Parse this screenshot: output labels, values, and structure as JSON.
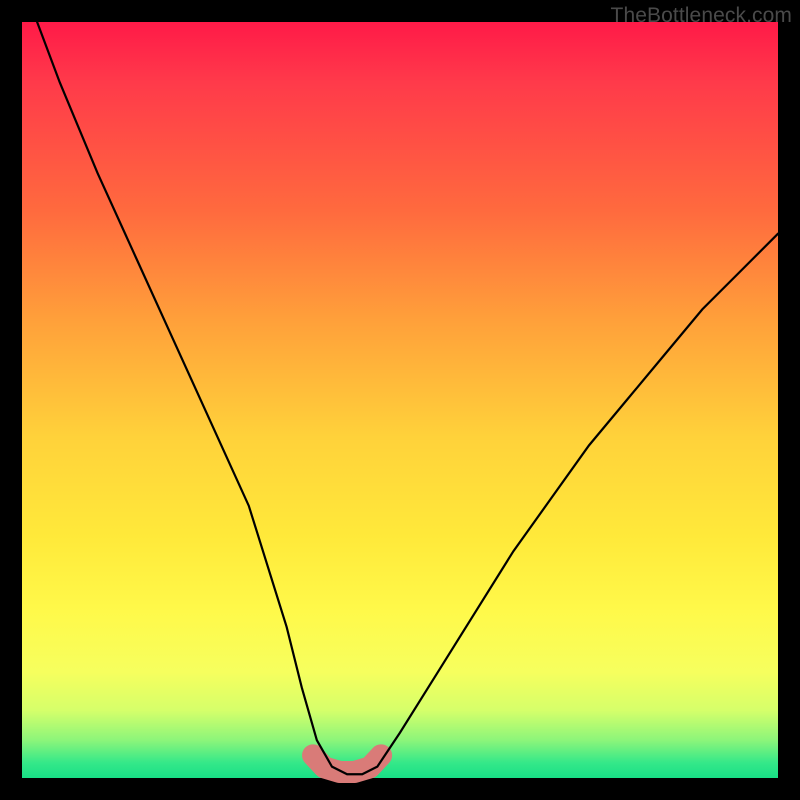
{
  "watermark": "TheBottleneck.com",
  "chart_data": {
    "type": "line",
    "title": "",
    "xlabel": "",
    "ylabel": "",
    "xlim": [
      0,
      100
    ],
    "ylim": [
      0,
      100
    ],
    "series": [
      {
        "name": "bottleneck-curve",
        "x": [
          2,
          5,
          10,
          15,
          20,
          25,
          30,
          35,
          37,
          39,
          41,
          43,
          45,
          47,
          50,
          55,
          60,
          65,
          70,
          75,
          80,
          85,
          90,
          95,
          100
        ],
        "values": [
          100,
          92,
          80,
          69,
          58,
          47,
          36,
          20,
          12,
          5,
          1.5,
          0.5,
          0.5,
          1.5,
          6,
          14,
          22,
          30,
          37,
          44,
          50,
          56,
          62,
          67,
          72
        ]
      },
      {
        "name": "highlight-band",
        "x": [
          38.5,
          40,
          42,
          44,
          46,
          47.5
        ],
        "values": [
          3.0,
          1.4,
          0.8,
          0.8,
          1.4,
          3.0
        ]
      }
    ],
    "colors": {
      "curve": "#000000",
      "highlight": "#d97b78"
    },
    "gradient_stops": [
      {
        "pos": 0,
        "color": "#ff1a48"
      },
      {
        "pos": 25,
        "color": "#ff6a3e"
      },
      {
        "pos": 55,
        "color": "#ffd23a"
      },
      {
        "pos": 78,
        "color": "#fff94a"
      },
      {
        "pos": 95,
        "color": "#8cf57a"
      },
      {
        "pos": 100,
        "color": "#18df86"
      }
    ]
  }
}
